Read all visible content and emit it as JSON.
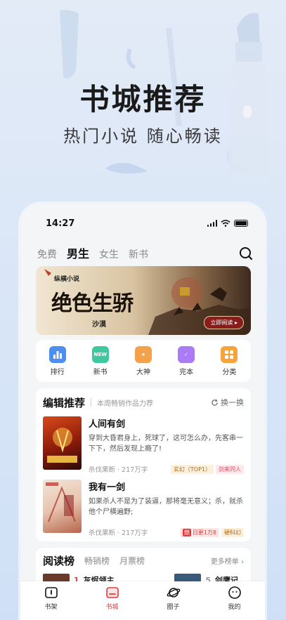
{
  "hero": {
    "title": "书城推荐",
    "subtitle": "热门小说  随心畅读"
  },
  "status_bar": {
    "time": "14:27"
  },
  "tabs": [
    {
      "label": "免费"
    },
    {
      "label": "男生"
    },
    {
      "label": "女生"
    },
    {
      "label": "新书"
    }
  ],
  "active_tab": "男生",
  "banner": {
    "logo": "纵横小说",
    "title": "绝色生骄",
    "author": "沙漠",
    "button": "立即阅读 ▸"
  },
  "categories": [
    {
      "label": "排行",
      "icon": "ranking-icon",
      "color": "#4c8ff0"
    },
    {
      "label": "新书",
      "icon": "new-book-icon",
      "color": "#3fc8a0"
    },
    {
      "label": "大神",
      "icon": "star-badge-icon",
      "color": "#f4a24a"
    },
    {
      "label": "完本",
      "icon": "checklist-icon",
      "color": "#a97cf5"
    },
    {
      "label": "分类",
      "icon": "grid-icon",
      "color": "#f5a33a"
    }
  ],
  "editor": {
    "title": "编辑推荐",
    "subtitle": "本周畅销作品力荐",
    "refresh": "换一换",
    "books": [
      {
        "title": "人间有剑",
        "desc": "穿到大昏君身上，死球了，这可怎么办，先客串一下下，然后发现上瘾了!",
        "meta": "杀伐果断 · 217万字",
        "tags": [
          {
            "text": "玄幻（TOP1）",
            "color": "#b06a16",
            "bg": "#fbf0dc"
          },
          {
            "text": "剑来同人",
            "color": "#e0495a",
            "bg": "#fde9ec"
          }
        ]
      },
      {
        "title": "我有一剑",
        "desc": "如果杀人不是为了装逼，那将毫无意义；杀，就杀他个尸横遍野;",
        "meta": "杀伐果断 · 217万字",
        "tags": [
          {
            "text": "日更1万8",
            "color": "#e23a3a",
            "bg": "#fde7e7",
            "badge": "燃"
          },
          {
            "text": "硬科幻",
            "color": "#b06a16",
            "bg": "#fbf0dc"
          }
        ]
      }
    ]
  },
  "ranking": {
    "tabs": [
      {
        "label": "阅读榜"
      },
      {
        "label": "畅销榜"
      },
      {
        "label": "月票榜"
      }
    ],
    "more": "更多榜单 ›",
    "rows": [
      {
        "rank": "1",
        "name": "灰烬领主"
      },
      {
        "rank": "5",
        "name": "剑鹰记"
      }
    ]
  },
  "nav": [
    {
      "label": "书架",
      "icon": "bookshelf-icon"
    },
    {
      "label": "书城",
      "icon": "bookstore-icon",
      "active": true
    },
    {
      "label": "圈子",
      "icon": "planet-icon"
    },
    {
      "label": "我的",
      "icon": "profile-icon"
    }
  ],
  "colors": {
    "accent": "#e23a3a",
    "background": "#d8e5f7"
  }
}
